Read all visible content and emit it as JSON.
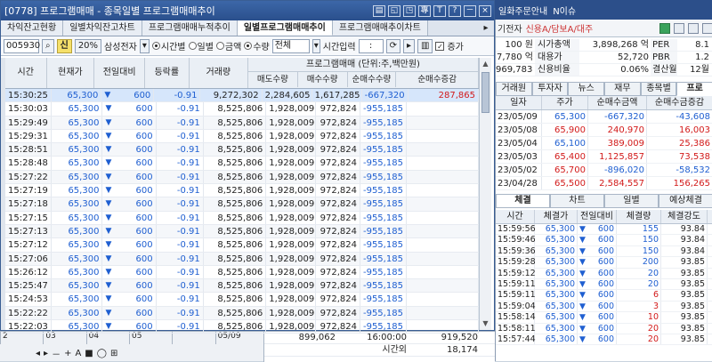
{
  "window": {
    "title": "[0778] 프로그램매매 - 종목일별 프로그램매매추이",
    "title_buttons": [
      "▤",
      "◱",
      "◳",
      "專",
      "T",
      "?",
      "－",
      "×"
    ]
  },
  "tabs": [
    "차익잔고현황",
    "일별차익잔고차트",
    "프로그램매매누적추이",
    "일별프로그램매매추이",
    "프로그램매매추이차트"
  ],
  "active_tab": 3,
  "toolbar": {
    "code": "005930",
    "credit_label": "신",
    "margin_label": "20%",
    "stock_name": "삼성전자",
    "radio_time": "시간별",
    "radio_day": "일별",
    "radio_amount": "금액",
    "radio_qty": "수량",
    "select_all": "전체",
    "time_input_label": "시간입력",
    "time_input_value": ":",
    "check_label": "증가"
  },
  "grid": {
    "headers": {
      "time": "시간",
      "price": "현재가",
      "change": "전일대비",
      "rate": "등락률",
      "volume": "거래량",
      "group": "프로그램매매 (단위:주,백만원)",
      "sell": "매도수량",
      "buy": "매수수량",
      "net": "순매수수량",
      "inc": "순매수증감"
    },
    "rows": [
      {
        "time": "15:30:25",
        "price": "65,300",
        "chg": "600",
        "rate": "-0.91",
        "vol": "9,272,302",
        "sell": "2,284,605",
        "buy": "1,617,285",
        "net": "-667,320",
        "inc": "287,865"
      },
      {
        "time": "15:30:03",
        "price": "65,300",
        "chg": "600",
        "rate": "-0.91",
        "vol": "8,525,806",
        "sell": "1,928,009",
        "buy": "972,824",
        "net": "-955,185",
        "inc": ""
      },
      {
        "time": "15:29:49",
        "price": "65,300",
        "chg": "600",
        "rate": "-0.91",
        "vol": "8,525,806",
        "sell": "1,928,009",
        "buy": "972,824",
        "net": "-955,185",
        "inc": ""
      },
      {
        "time": "15:29:31",
        "price": "65,300",
        "chg": "600",
        "rate": "-0.91",
        "vol": "8,525,806",
        "sell": "1,928,009",
        "buy": "972,824",
        "net": "-955,185",
        "inc": ""
      },
      {
        "time": "15:28:51",
        "price": "65,300",
        "chg": "600",
        "rate": "-0.91",
        "vol": "8,525,806",
        "sell": "1,928,009",
        "buy": "972,824",
        "net": "-955,185",
        "inc": ""
      },
      {
        "time": "15:28:48",
        "price": "65,300",
        "chg": "600",
        "rate": "-0.91",
        "vol": "8,525,806",
        "sell": "1,928,009",
        "buy": "972,824",
        "net": "-955,185",
        "inc": ""
      },
      {
        "time": "15:27:22",
        "price": "65,300",
        "chg": "600",
        "rate": "-0.91",
        "vol": "8,525,806",
        "sell": "1,928,009",
        "buy": "972,824",
        "net": "-955,185",
        "inc": ""
      },
      {
        "time": "15:27:19",
        "price": "65,300",
        "chg": "600",
        "rate": "-0.91",
        "vol": "8,525,806",
        "sell": "1,928,009",
        "buy": "972,824",
        "net": "-955,185",
        "inc": ""
      },
      {
        "time": "15:27:18",
        "price": "65,300",
        "chg": "600",
        "rate": "-0.91",
        "vol": "8,525,806",
        "sell": "1,928,009",
        "buy": "972,824",
        "net": "-955,185",
        "inc": ""
      },
      {
        "time": "15:27:15",
        "price": "65,300",
        "chg": "600",
        "rate": "-0.91",
        "vol": "8,525,806",
        "sell": "1,928,009",
        "buy": "972,824",
        "net": "-955,185",
        "inc": ""
      },
      {
        "time": "15:27:13",
        "price": "65,300",
        "chg": "600",
        "rate": "-0.91",
        "vol": "8,525,806",
        "sell": "1,928,009",
        "buy": "972,824",
        "net": "-955,185",
        "inc": ""
      },
      {
        "time": "15:27:12",
        "price": "65,300",
        "chg": "600",
        "rate": "-0.91",
        "vol": "8,525,806",
        "sell": "1,928,009",
        "buy": "972,824",
        "net": "-955,185",
        "inc": ""
      },
      {
        "time": "15:27:06",
        "price": "65,300",
        "chg": "600",
        "rate": "-0.91",
        "vol": "8,525,806",
        "sell": "1,928,009",
        "buy": "972,824",
        "net": "-955,185",
        "inc": ""
      },
      {
        "time": "15:26:12",
        "price": "65,300",
        "chg": "600",
        "rate": "-0.91",
        "vol": "8,525,806",
        "sell": "1,928,009",
        "buy": "972,824",
        "net": "-955,185",
        "inc": ""
      },
      {
        "time": "15:25:47",
        "price": "65,300",
        "chg": "600",
        "rate": "-0.91",
        "vol": "8,525,806",
        "sell": "1,928,009",
        "buy": "972,824",
        "net": "-955,185",
        "inc": ""
      },
      {
        "time": "15:24:53",
        "price": "65,300",
        "chg": "600",
        "rate": "-0.91",
        "vol": "8,525,806",
        "sell": "1,928,009",
        "buy": "972,824",
        "net": "-955,185",
        "inc": ""
      },
      {
        "time": "15:22:22",
        "price": "65,300",
        "chg": "600",
        "rate": "-0.91",
        "vol": "8,525,806",
        "sell": "1,928,009",
        "buy": "972,824",
        "net": "-955,185",
        "inc": ""
      },
      {
        "time": "15:22:03",
        "price": "65,300",
        "chg": "600",
        "rate": "-0.91",
        "vol": "8,525,806",
        "sell": "1,928,009",
        "buy": "972,824",
        "net": "-955,185",
        "inc": ""
      }
    ]
  },
  "right_top": {
    "topbar": [
      "일화주문안내",
      "N이슈"
    ],
    "row1_label": "기전자",
    "row1_value": "신용A/담보A/대주",
    "info": [
      {
        "a": "100 원",
        "b": "시가총액",
        "c": "3,898,268 억",
        "d": "PER",
        "e": "8.1"
      },
      {
        "a": "7,780 억",
        "b": "대용가",
        "c": "52,720",
        "d": "PBR",
        "e": "1.2"
      },
      {
        "a": "969,783 천",
        "b": "신용비율",
        "c": "0.06%",
        "d": "결산월",
        "e": "12월"
      }
    ],
    "tabs": [
      "거래원",
      "투자자",
      "뉴스",
      "재무",
      "종목별",
      "프로"
    ],
    "table_headers": [
      "일자",
      "주가",
      "순매수금액",
      "순매수금증감"
    ],
    "rows": [
      {
        "d": "23/05/09",
        "p": "65,300",
        "n": "-667,320",
        "i": "-43,608",
        "pc": "blue",
        "nc": "blue",
        "ic": "blue"
      },
      {
        "d": "23/05/08",
        "p": "65,900",
        "n": "240,970",
        "i": "16,003",
        "pc": "red",
        "nc": "red",
        "ic": "red"
      },
      {
        "d": "23/05/04",
        "p": "65,100",
        "n": "389,009",
        "i": "25,386",
        "pc": "blue",
        "nc": "red",
        "ic": "red"
      },
      {
        "d": "23/05/03",
        "p": "65,400",
        "n": "1,125,857",
        "i": "73,538",
        "pc": "red",
        "nc": "red",
        "ic": "red"
      },
      {
        "d": "23/05/02",
        "p": "65,700",
        "n": "-896,020",
        "i": "-58,532",
        "pc": "red",
        "nc": "blue",
        "ic": "blue"
      },
      {
        "d": "23/04/28",
        "p": "65,500",
        "n": "2,584,557",
        "i": "156,265",
        "pc": "red",
        "nc": "red",
        "ic": "red"
      }
    ]
  },
  "right_bottom": {
    "tabs": [
      "체결",
      "차트",
      "일별",
      "예상체결"
    ],
    "headers": [
      "시간",
      "체결가",
      "전일대비",
      "체결량",
      "체결강도"
    ],
    "rows": [
      {
        "t": "15:59:56",
        "p": "65,300",
        "c": "600",
        "q": "155",
        "s": "93.84",
        "qc": "blue"
      },
      {
        "t": "15:59:46",
        "p": "65,300",
        "c": "600",
        "q": "150",
        "s": "93.84",
        "qc": "blue"
      },
      {
        "t": "15:59:36",
        "p": "65,300",
        "c": "600",
        "q": "150",
        "s": "93.84",
        "qc": "blue"
      },
      {
        "t": "15:59:28",
        "p": "65,300",
        "c": "600",
        "q": "200",
        "s": "93.85",
        "qc": "blue"
      },
      {
        "t": "15:59:12",
        "p": "65,300",
        "c": "600",
        "q": "20",
        "s": "93.85",
        "qc": "blue"
      },
      {
        "t": "15:59:11",
        "p": "65,300",
        "c": "600",
        "q": "20",
        "s": "93.85",
        "qc": "blue"
      },
      {
        "t": "15:59:11",
        "p": "65,300",
        "c": "600",
        "q": "6",
        "s": "93.85",
        "qc": "red"
      },
      {
        "t": "15:59:04",
        "p": "65,300",
        "c": "600",
        "q": "3",
        "s": "93.85",
        "qc": "red"
      },
      {
        "t": "15:58:14",
        "p": "65,300",
        "c": "600",
        "q": "10",
        "s": "93.85",
        "qc": "red"
      },
      {
        "t": "15:58:11",
        "p": "65,300",
        "c": "600",
        "q": "20",
        "s": "93.85",
        "qc": "red"
      },
      {
        "t": "15:57:44",
        "p": "65,300",
        "c": "600",
        "q": "20",
        "s": "93.85",
        "qc": "red"
      }
    ]
  },
  "bottom": {
    "axis": [
      "2",
      "03",
      "04",
      "05",
      "",
      "05/09"
    ],
    "tools": [
      "◂",
      "▸",
      "－",
      "+",
      "A",
      "■",
      "◯",
      "⊞"
    ],
    "stat_v": "899,062",
    "stat_time": "16:00:00",
    "stat_vol": "919,520",
    "stat_label": "시간외",
    "stat_vol2": "18,174"
  }
}
